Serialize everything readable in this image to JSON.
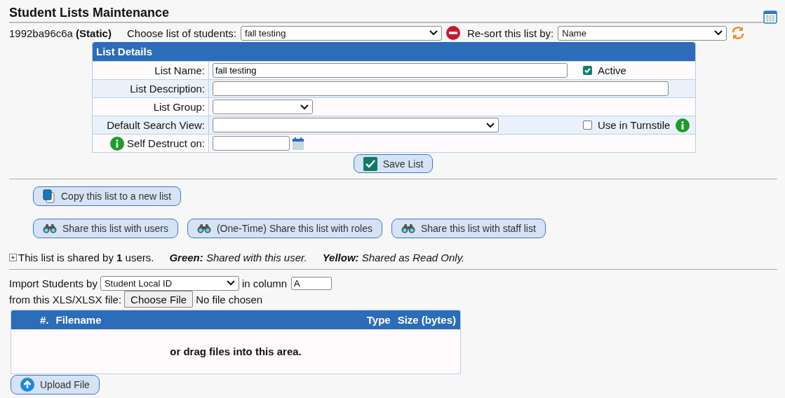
{
  "title": "Student Lists Maintenance",
  "list_id": "1992ba96c6a",
  "list_type": "(Static)",
  "choose_list": {
    "label": "Choose list of students:",
    "value": "fall testing"
  },
  "resort": {
    "label": "Re-sort this list by:",
    "value": "Name"
  },
  "list_details": {
    "title": "List Details",
    "rows": [
      {
        "kind": "text",
        "label": "List Name:",
        "value": "fall testing",
        "checkbox": {
          "label": "Active",
          "checked": true,
          "info": false
        }
      },
      {
        "kind": "long-text",
        "label": "List Description:"
      },
      {
        "kind": "select",
        "label": "List Group:"
      },
      {
        "kind": "long-select",
        "label": "Default Search View:",
        "checkbox": {
          "label": "Use in Turnstile",
          "checked": false,
          "info": true
        }
      },
      {
        "kind": "date",
        "label": "Self Destruct on:",
        "info": true
      }
    ],
    "save_button": "Save List"
  },
  "actions": [
    [
      {
        "kind": "copy",
        "label": "Copy this list to a new list"
      }
    ],
    [
      {
        "kind": "share",
        "label": "Share this list with users"
      },
      {
        "kind": "share",
        "label": "(One-Time) Share this list with roles"
      },
      {
        "kind": "share",
        "label": "Share this list with staff list"
      }
    ]
  ],
  "shared_info": {
    "expanded": false,
    "text": "This list is shared by **1** users.",
    "legend": [
      "**Green:** Shared with this user.",
      "**Yellow:** Shared as Read Only."
    ]
  },
  "import": {
    "label": "Import Students by",
    "by": "Student Local ID",
    "column_label": "in column",
    "column": "A",
    "file_label": "from this XLS/XLSX file:",
    "choose_button": "Choose File",
    "file_status": "No file chosen"
  },
  "upload_table": {
    "columns": [
      "#.",
      "Filename",
      "Type",
      "Size (bytes)"
    ],
    "drop_hint": "or drag files into this area.",
    "upload_button": "Upload File"
  }
}
